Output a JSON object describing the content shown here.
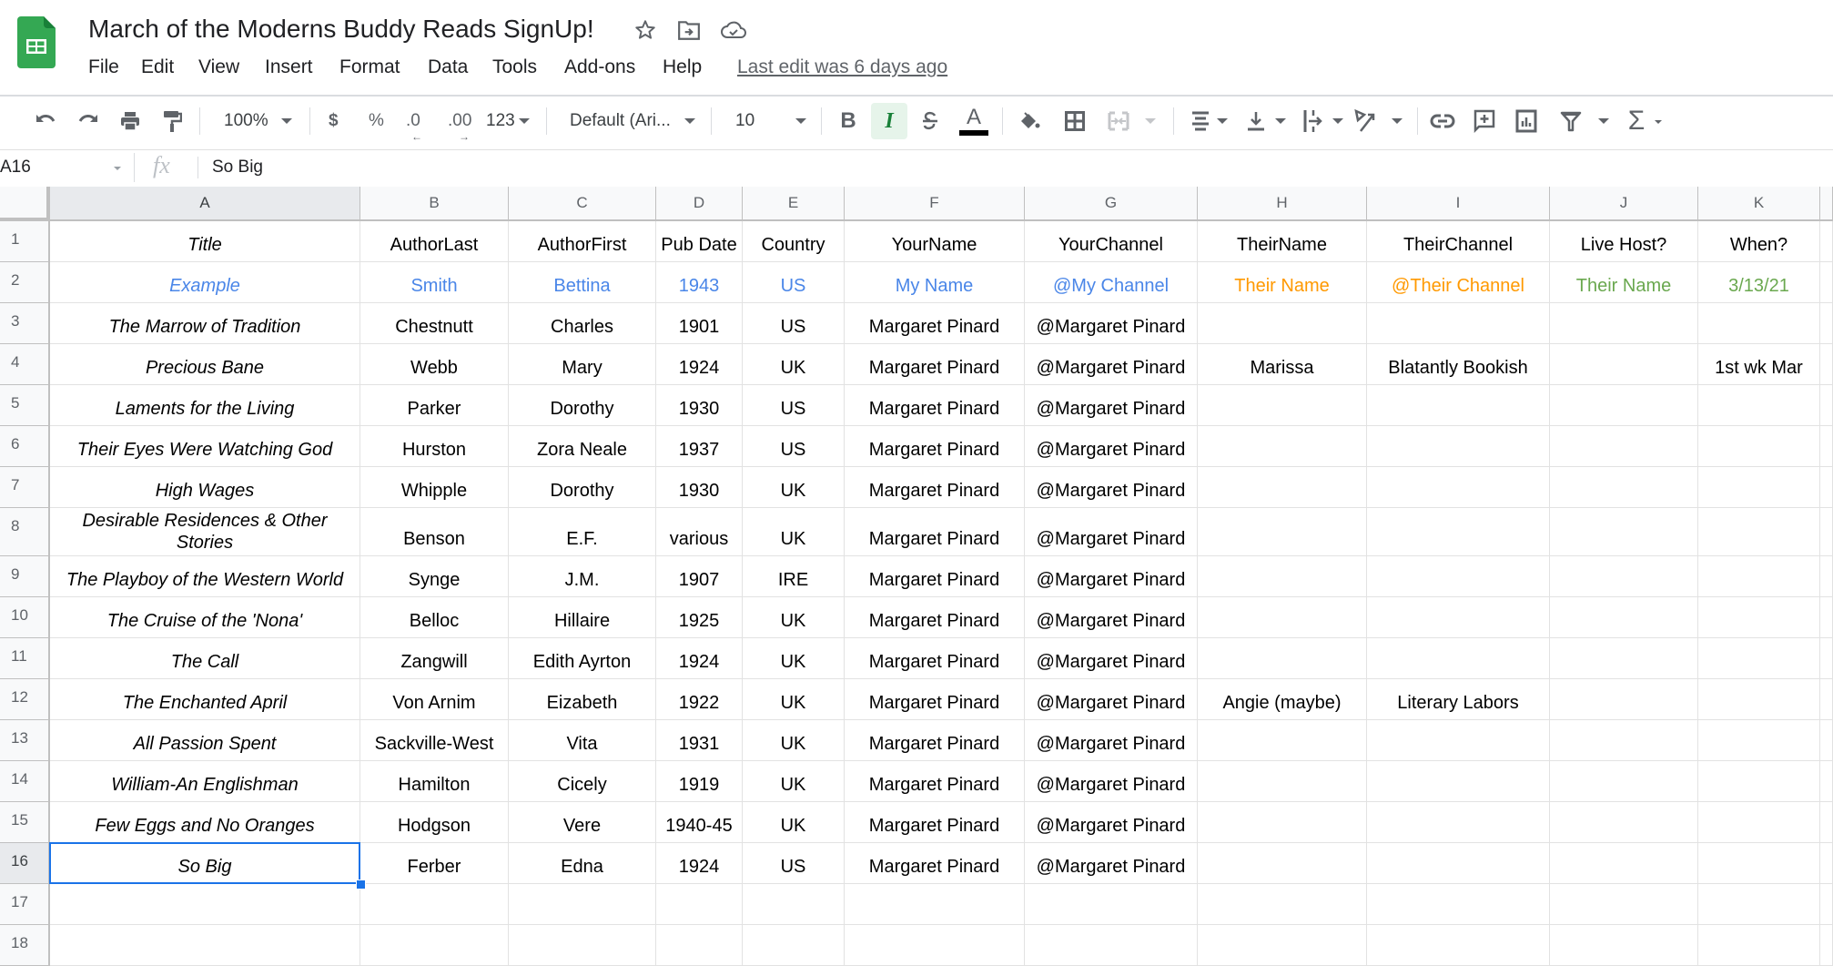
{
  "app": {
    "doc_title": "March of the Moderns Buddy Reads SignUp!",
    "icons": [
      "sheets-logo-icon",
      "star-icon",
      "move-to-folder-icon",
      "cloud-saved-icon"
    ]
  },
  "menu": {
    "items": [
      "File",
      "Edit",
      "View",
      "Insert",
      "Format",
      "Data",
      "Tools",
      "Add-ons",
      "Help"
    ],
    "last_edit": "Last edit was 6 days ago"
  },
  "toolbar": {
    "zoom": "100%",
    "currency": "$",
    "percent": "%",
    "decrease_decimal": ".0",
    "increase_decimal": ".00",
    "more_formats": "123",
    "font": "Default (Ari...",
    "font_size": "10",
    "italic_active": true
  },
  "formula_bar": {
    "name_box": "A16",
    "fx_label": "fx",
    "value": "So Big"
  },
  "sheet": {
    "columns": [
      "A",
      "B",
      "C",
      "D",
      "E",
      "F",
      "G",
      "H",
      "I",
      "J",
      "K"
    ],
    "selected_cell": "A16",
    "row_numbers": [
      "1",
      "2",
      "3",
      "4",
      "5",
      "6",
      "7",
      "8",
      "9",
      "10",
      "11",
      "12",
      "13",
      "14",
      "15",
      "16",
      "17",
      "18"
    ],
    "rows": [
      [
        "Title",
        "AuthorLast",
        "AuthorFirst",
        "Pub Date",
        "Country",
        "YourName",
        "YourChannel",
        "TheirName",
        "TheirChannel",
        "Live Host?",
        "When?"
      ],
      [
        "Example",
        "Smith",
        "Bettina",
        "1943",
        "US",
        "My Name",
        "@My Channel",
        "Their Name",
        "@Their Channel",
        "Their Name",
        "3/13/21"
      ],
      [
        "The Marrow of Tradition",
        "Chestnutt",
        "Charles",
        "1901",
        "US",
        "Margaret Pinard",
        "@Margaret Pinard",
        "",
        "",
        "",
        ""
      ],
      [
        "Precious Bane",
        "Webb",
        "Mary",
        "1924",
        "UK",
        "Margaret Pinard",
        "@Margaret Pinard",
        "Marissa",
        "Blatantly Bookish",
        "",
        "1st wk Mar"
      ],
      [
        "Laments for the Living",
        "Parker",
        "Dorothy",
        "1930",
        "US",
        "Margaret Pinard",
        "@Margaret Pinard",
        "",
        "",
        "",
        ""
      ],
      [
        "Their Eyes Were Watching God",
        "Hurston",
        "Zora Neale",
        "1937",
        "US",
        "Margaret Pinard",
        "@Margaret Pinard",
        "",
        "",
        "",
        ""
      ],
      [
        "High Wages",
        "Whipple",
        "Dorothy",
        "1930",
        "UK",
        "Margaret Pinard",
        "@Margaret Pinard",
        "",
        "",
        "",
        ""
      ],
      [
        "Desirable Residences & Other Stories",
        "Benson",
        "E.F.",
        "various",
        "UK",
        "Margaret Pinard",
        "@Margaret Pinard",
        "",
        "",
        "",
        ""
      ],
      [
        "The Playboy of the Western World",
        "Synge",
        "J.M.",
        "1907",
        "IRE",
        "Margaret Pinard",
        "@Margaret Pinard",
        "",
        "",
        "",
        ""
      ],
      [
        "The Cruise of the 'Nona'",
        "Belloc",
        "Hillaire",
        "1925",
        "UK",
        "Margaret Pinard",
        "@Margaret Pinard",
        "",
        "",
        "",
        ""
      ],
      [
        "The Call",
        "Zangwill",
        "Edith Ayrton",
        "1924",
        "UK",
        "Margaret Pinard",
        "@Margaret Pinard",
        "",
        "",
        "",
        ""
      ],
      [
        "The Enchanted April",
        "Von Arnim",
        "Eizabeth",
        "1922",
        "UK",
        "Margaret Pinard",
        "@Margaret Pinard",
        "Angie (maybe)",
        "Literary Labors",
        "",
        ""
      ],
      [
        "All Passion Spent",
        "Sackville-West",
        "Vita",
        "1931",
        "UK",
        "Margaret Pinard",
        "@Margaret Pinard",
        "",
        "",
        "",
        ""
      ],
      [
        "William-An Englishman",
        "Hamilton",
        "Cicely",
        "1919",
        "UK",
        "Margaret Pinard",
        "@Margaret Pinard",
        "",
        "",
        "",
        ""
      ],
      [
        "Few Eggs and No Oranges",
        "Hodgson",
        "Vere",
        "1940-45",
        "UK",
        "Margaret Pinard",
        "@Margaret Pinard",
        "",
        "",
        "",
        ""
      ],
      [
        "So Big",
        "Ferber",
        "Edna",
        "1924",
        "US",
        "Margaret Pinard",
        "@Margaret Pinard",
        "",
        "",
        "",
        ""
      ],
      [
        "",
        "",
        "",
        "",
        "",
        "",
        "",
        "",
        "",
        "",
        ""
      ],
      [
        "",
        "",
        "",
        "",
        "",
        "",
        "",
        "",
        "",
        "",
        ""
      ]
    ],
    "example_row_colors": [
      "#4a86e8",
      "#4a86e8",
      "#4a86e8",
      "#4a86e8",
      "#4a86e8",
      "#4a86e8",
      "#4a86e8",
      "#ff9900",
      "#ff9900",
      "#6aa84f",
      "#6aa84f"
    ]
  },
  "colors": {
    "selection": "#1a73e8",
    "sheets_green": "#34a853"
  }
}
